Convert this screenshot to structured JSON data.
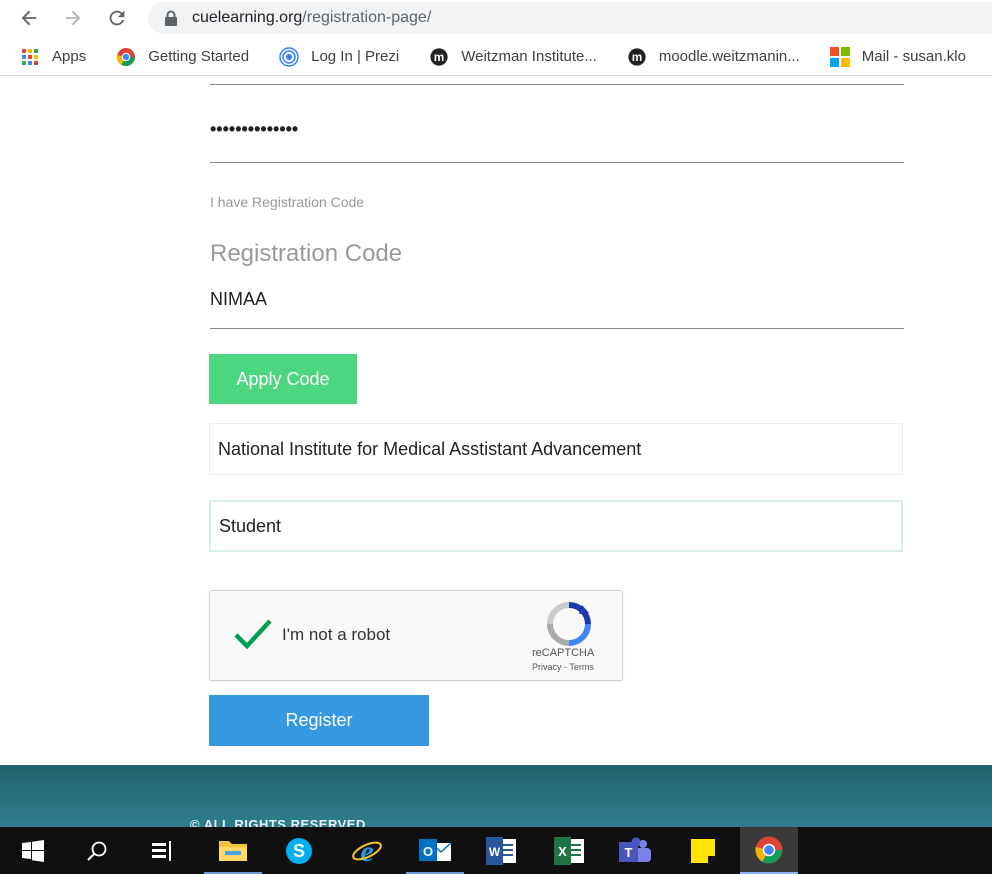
{
  "browser": {
    "url_host": "cuelearning.org",
    "url_path": "/registration-page/",
    "bookmarks": [
      {
        "label": "Apps",
        "icon": "apps-grid-icon"
      },
      {
        "label": "Getting Started",
        "icon": "chrome-icon"
      },
      {
        "label": "Log In | Prezi",
        "icon": "prezi-icon"
      },
      {
        "label": "Weitzman Institute...",
        "icon": "moodle-icon"
      },
      {
        "label": "moodle.weitzmanin...",
        "icon": "moodle-icon"
      },
      {
        "label": "Mail - susan.klo",
        "icon": "microsoft-icon"
      }
    ]
  },
  "form": {
    "password_masked": "••••••••••••••",
    "registration_toggle": "I have Registration Code",
    "registration_label": "Registration Code",
    "registration_value": "NIMAA",
    "apply_button": "Apply Code",
    "organization": "National Institute for Medical Asstistant Advancement",
    "role": "Student",
    "captcha_label": "I'm not a robot",
    "captcha_brand": "reCAPTCHA",
    "captcha_links": "Privacy - Terms",
    "register_button": "Register"
  },
  "footer": {
    "copyright": "©  ALL RIGHTS RESERVED"
  },
  "taskbar": {
    "items": [
      "start",
      "search",
      "task-view",
      "file-explorer",
      "skype",
      "internet-explorer",
      "outlook",
      "word",
      "excel",
      "teams",
      "sticky-notes",
      "chrome"
    ]
  },
  "colors": {
    "apply_button": "#4cd67f",
    "register_button": "#3598e0",
    "footer": "#2a6f7e"
  }
}
